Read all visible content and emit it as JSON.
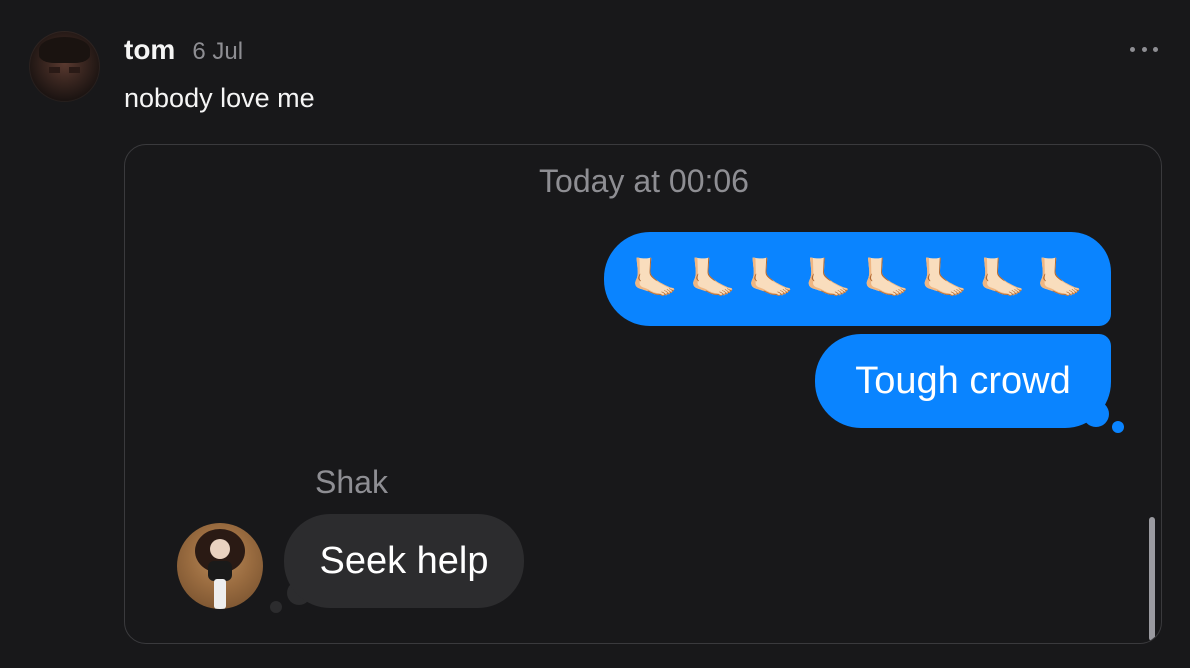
{
  "post": {
    "username": "tom",
    "date": "6 Jul",
    "text": "nobody love me"
  },
  "icons": {
    "avatar": "user-avatar",
    "more": "more-horizontal-icon"
  },
  "conversation": {
    "timestamp": "Today at 00:06",
    "outgoing": [
      {
        "text": "🦶🏻 🦶🏻 🦶🏻 🦶🏻 🦶🏻 🦶🏻 🦶🏻 🦶🏻"
      },
      {
        "text": "Tough crowd"
      }
    ],
    "incoming": {
      "sender": "Shak",
      "text": "Seek help"
    }
  },
  "colors": {
    "background": "#18181a",
    "outgoing_bubble": "#0a84ff",
    "incoming_bubble": "#2c2c2e",
    "muted_text": "#8e8e93"
  }
}
